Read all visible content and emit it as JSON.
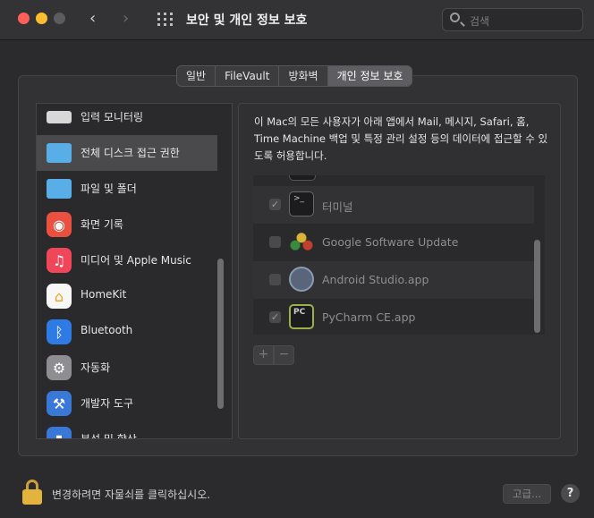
{
  "window": {
    "title": "보안 및 개인 정보 보호",
    "search_placeholder": "검색"
  },
  "tabs": [
    {
      "label": "일반",
      "active": false
    },
    {
      "label": "FileVault",
      "active": false
    },
    {
      "label": "방화벽",
      "active": false
    },
    {
      "label": "개인 정보 보호",
      "active": true
    }
  ],
  "sidebar": {
    "items": [
      {
        "label": "입력 모니터링",
        "icon": "keyboard-icon",
        "selected": false
      },
      {
        "label": "전체 디스크 접근 권한",
        "icon": "folder-icon",
        "selected": true
      },
      {
        "label": "파일 및 폴더",
        "icon": "folder-icon",
        "selected": false
      },
      {
        "label": "화면 기록",
        "icon": "screen-record-icon",
        "selected": false
      },
      {
        "label": "미디어 및 Apple Music",
        "icon": "music-icon",
        "selected": false
      },
      {
        "label": "HomeKit",
        "icon": "home-icon",
        "selected": false
      },
      {
        "label": "Bluetooth",
        "icon": "bluetooth-icon",
        "selected": false
      },
      {
        "label": "자동화",
        "icon": "gear-icon",
        "selected": false
      },
      {
        "label": "개발자 도구",
        "icon": "developer-tools-icon",
        "selected": false
      },
      {
        "label": "분석 및 향상",
        "icon": "analytics-icon",
        "selected": false
      }
    ]
  },
  "description": "이 Mac의 모든 사용자가 아래 앱에서 Mail, 메시지, Safari, 홈, Time Machine 백업 및 특정 관리 설정 등의 데이터에 접근할 수 있도록 허용합니다.",
  "apps": [
    {
      "name": "터미널",
      "checked": true,
      "icon": "terminal-icon"
    },
    {
      "name": "Google Software Update",
      "checked": false,
      "icon": "google-update-icon"
    },
    {
      "name": "Android Studio.app",
      "checked": false,
      "icon": "android-studio-icon"
    },
    {
      "name": "PyCharm CE.app",
      "checked": true,
      "icon": "pycharm-icon"
    }
  ],
  "list_controls": {
    "add": "+",
    "remove": "−"
  },
  "footer": {
    "lock_text": "변경하려면 자물쇠를 클릭하십시오.",
    "advanced_label": "고급...",
    "help_label": "?"
  },
  "colors": {
    "window_bg": "#2b2b2d",
    "selection": "#4a4a4d",
    "folder_blue": "#5aaee8",
    "lock_gold": "#e2b43e"
  }
}
